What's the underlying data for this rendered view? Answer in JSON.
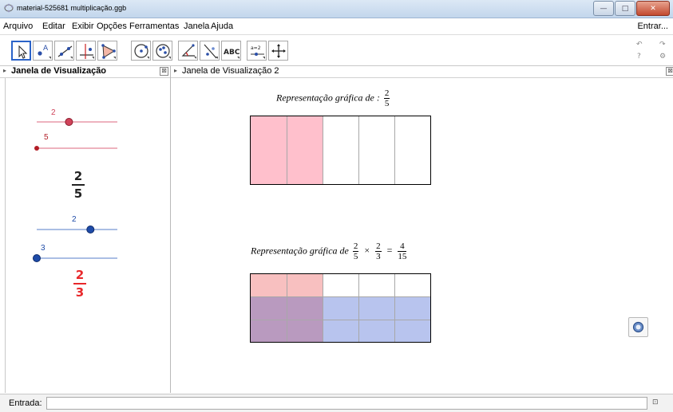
{
  "window": {
    "title": "material-525681 multiplicação.ggb",
    "minimize_glyph": "—",
    "maximize_glyph": "□",
    "close_glyph": "✕"
  },
  "menu": {
    "items": [
      "Arquivo",
      "Editar",
      "Exibir",
      "Opções",
      "Ferramentas",
      "Janela",
      "Ajuda"
    ],
    "signin": "Entrar..."
  },
  "toolbar": {
    "tools": [
      {
        "icon": "move-arrow-icon"
      },
      {
        "icon": "point-icon",
        "label": "A"
      },
      {
        "icon": "line-icon"
      },
      {
        "icon": "perpendicular-line-icon"
      },
      {
        "icon": "polygon-icon"
      },
      {
        "icon": "circle-icon"
      },
      {
        "icon": "conic-icon"
      },
      {
        "icon": "angle-icon"
      },
      {
        "icon": "reflect-icon"
      },
      {
        "icon": "text-icon",
        "label": "ABC"
      },
      {
        "icon": "slider-icon",
        "label": "a=2"
      },
      {
        "icon": "move-graphics-icon"
      }
    ],
    "undo_glyph": "↶",
    "redo_glyph": "↷",
    "help_glyph": "?",
    "settings_glyph": "⚙"
  },
  "left_panel": {
    "title": "Janela de Visualização",
    "close_glyph": "⊠",
    "sliders": [
      {
        "label": "2",
        "color": "#d0435a",
        "line_color": "#e99aa8",
        "value": 2,
        "min": 0,
        "max": 5
      },
      {
        "label": "5",
        "color": "#b21d26",
        "line_color": "#e99aa8",
        "value": 5,
        "min": 5,
        "max": 15
      },
      {
        "label": "2",
        "color": "#1e4ba8",
        "line_color": "#8ea8dc",
        "value": 2,
        "min": 0,
        "max": 3
      },
      {
        "label": "3",
        "color": "#1e4ba8",
        "line_color": "#8ea8dc",
        "value": 3,
        "min": 3,
        "max": 10
      }
    ],
    "fraction1": {
      "numerator": "2",
      "denominator": "5",
      "color": "#222222"
    },
    "fraction2": {
      "numerator": "2",
      "denominator": "3",
      "color": "#e8282b"
    }
  },
  "right_panel": {
    "title": "Janela de Visualização 2",
    "close_glyph": "⊠",
    "caption1": {
      "text": "Representação gráfica de :",
      "num": "2",
      "den": "5"
    },
    "caption2": {
      "text": "Representação gráfica de",
      "f1_num": "2",
      "f1_den": "5",
      "times": "×",
      "f2_num": "2",
      "f2_den": "3",
      "equals": "=",
      "r_num": "4",
      "r_den": "15"
    },
    "grid1": {
      "cols": 5,
      "rows": 1,
      "shaded_cols": 2,
      "shade_color": "#ffc0cc"
    },
    "grid2": {
      "cols": 5,
      "rows": 3,
      "shaded_cols": 2,
      "shaded_rows": 2,
      "col_color": "#f8c0c0",
      "row_color": "#b8c4ee",
      "overlap_color": "#b99abf"
    }
  },
  "input_bar": {
    "label": "Entrada:",
    "value": "",
    "help_glyph": "⊡"
  }
}
